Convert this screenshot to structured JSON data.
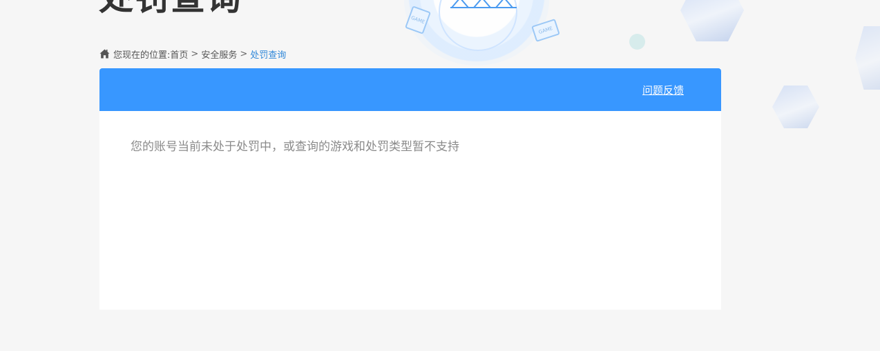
{
  "page": {
    "title": "处罚查询"
  },
  "breadcrumb": {
    "prefix": "您现在的位置:",
    "items": [
      "首页",
      "安全服务",
      "处罚查询"
    ],
    "separator": ">"
  },
  "panel": {
    "header_color": "#3897ff",
    "feedback_label": "问题反馈",
    "message": "您的账号当前未处于处罚中，或查询的游戏和处罚类型暂不支持"
  },
  "decoration": {
    "tag_text": "GAME"
  },
  "icons": {
    "home": "home-icon"
  },
  "colors": {
    "accent": "#3897ff",
    "link_current": "#2f87d8",
    "background": "#f6f6f6"
  }
}
